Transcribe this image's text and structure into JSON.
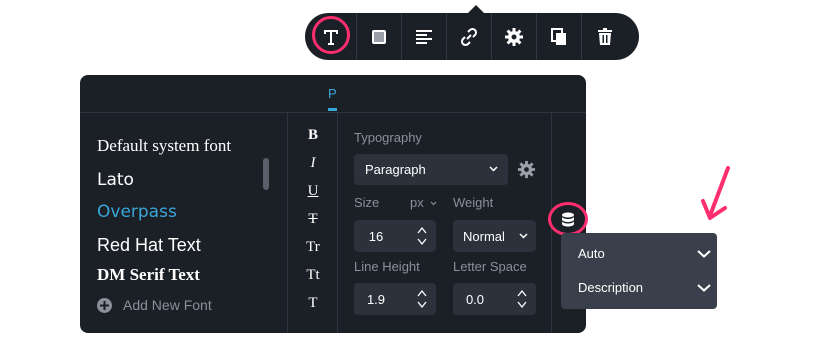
{
  "toolbar": {
    "buttons": [
      {
        "icon": "text-icon"
      },
      {
        "icon": "square-icon"
      },
      {
        "icon": "align-left-icon"
      },
      {
        "icon": "link-icon"
      },
      {
        "icon": "gear-icon"
      },
      {
        "icon": "copy-icon"
      },
      {
        "icon": "trash-icon"
      }
    ]
  },
  "panel": {
    "tab_label": "P",
    "fonts": [
      "Default system font",
      "Lato",
      "Overpass",
      "Red Hat Text",
      "DM Serif Text"
    ],
    "selected_font": "Overpass",
    "add_font_label": "Add New Font",
    "style_buttons": [
      "B",
      "I",
      "U",
      "T",
      "Tr",
      "Tt",
      "T"
    ],
    "typography": {
      "label": "Typography",
      "style_value": "Paragraph",
      "size_label": "Size",
      "size_unit": "px",
      "size_value": "16",
      "weight_label": "Weight",
      "weight_value": "Normal",
      "line_height_label": "Line Height",
      "line_height_value": "1.9",
      "letter_space_label": "Letter Space",
      "letter_space_value": "0.0"
    }
  },
  "dynamic_menu": {
    "items": [
      "Auto",
      "Description"
    ]
  },
  "colors": {
    "panel_bg": "#1b1f26",
    "accent": "#3aa7d9",
    "highlight": "#ff2e6f",
    "control_bg": "#2c323c"
  }
}
